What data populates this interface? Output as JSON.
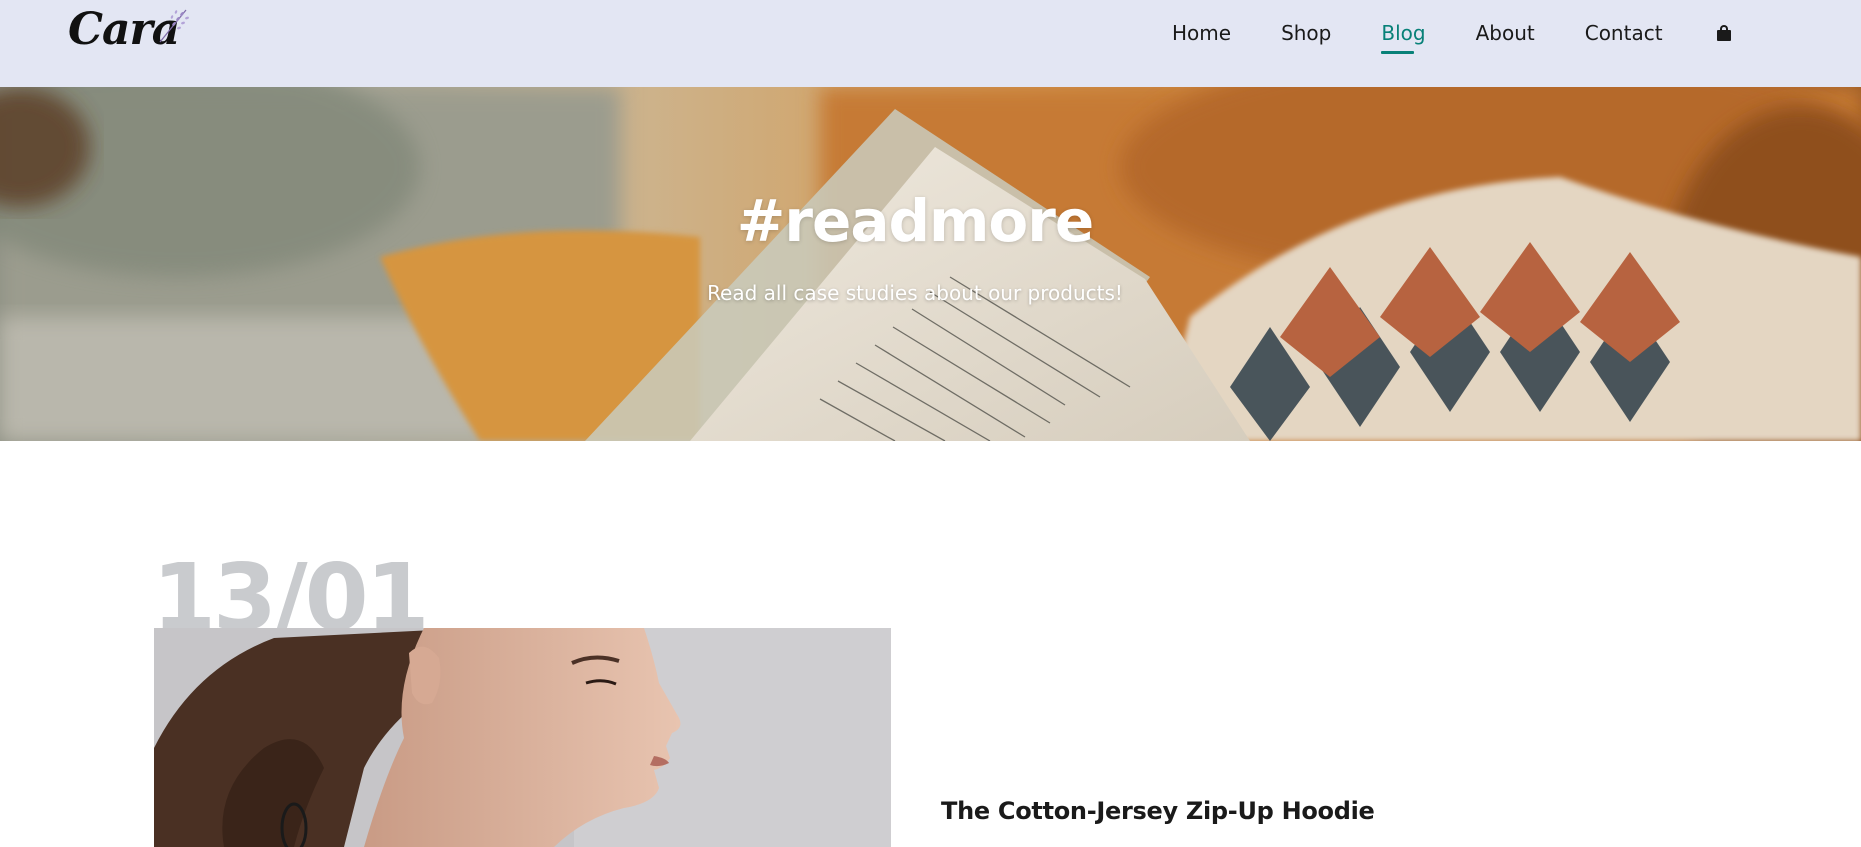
{
  "header": {
    "logo_text": "Cara",
    "nav": [
      {
        "label": "Home"
      },
      {
        "label": "Shop"
      },
      {
        "label": "Blog"
      },
      {
        "label": "About"
      },
      {
        "label": "Contact"
      }
    ],
    "cart_icon": "shopping-bag-icon",
    "active_nav": "Blog"
  },
  "hero": {
    "title": "#readmore",
    "subtitle": "Read all case studies about our products!"
  },
  "blog": {
    "posts": [
      {
        "date": "13/01",
        "title": "The Cotton-Jersey Zip-Up Hoodie"
      }
    ]
  },
  "colors": {
    "header_bg": "#e3e6f3",
    "accent": "#088178",
    "text": "#1a1a1a",
    "date_watermark": "#c9cbce"
  }
}
